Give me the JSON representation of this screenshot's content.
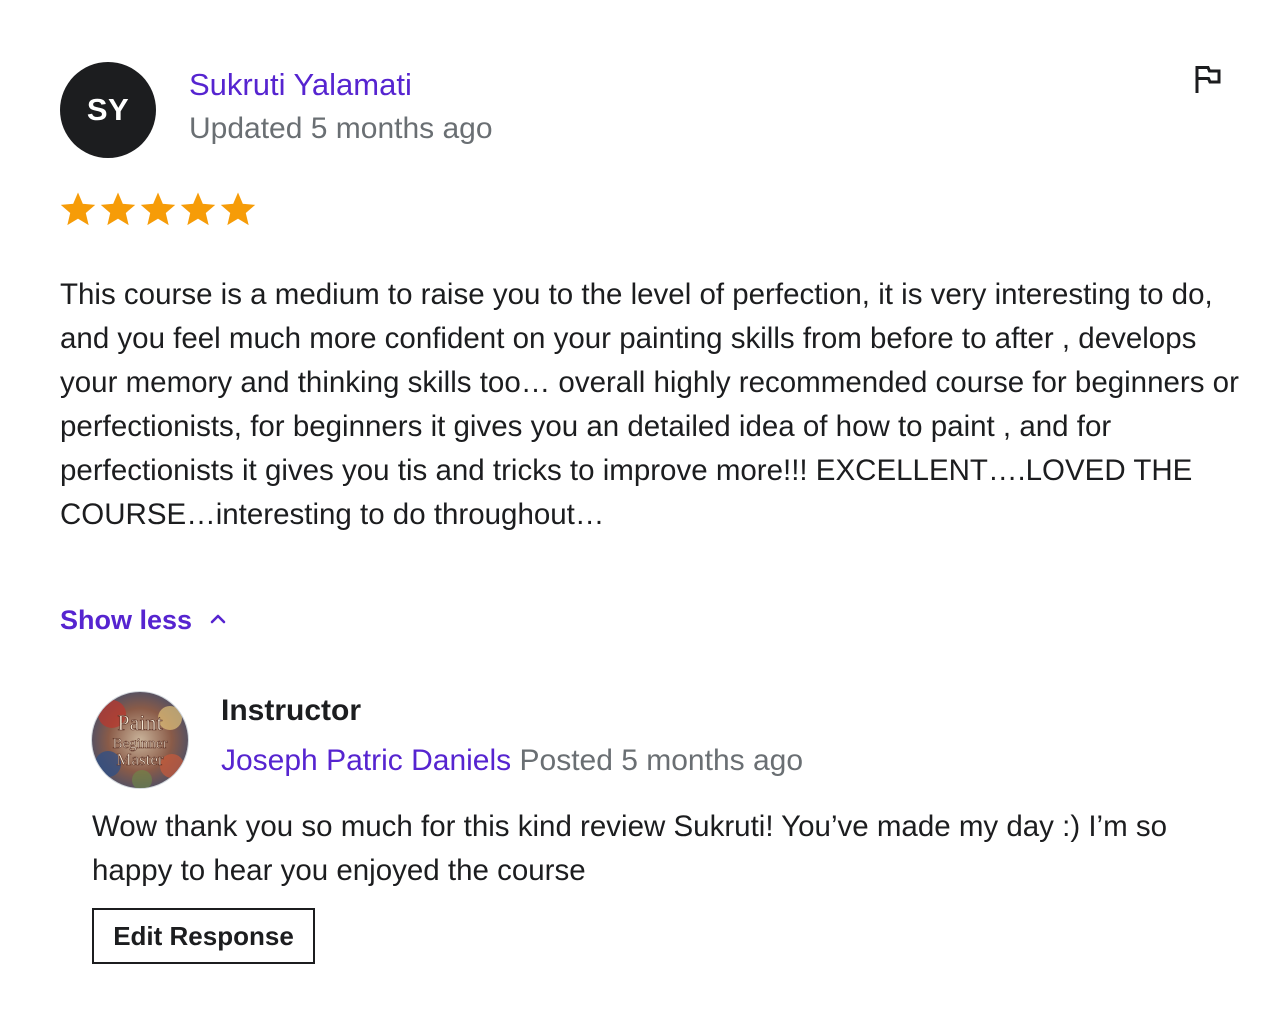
{
  "review": {
    "avatar_initials": "SY",
    "reviewer_name": "Sukruti Yalamati",
    "updated_text": "Updated 5 months ago",
    "rating": 5,
    "rating_max": 5,
    "star_color": "#f69c08",
    "text": "This course is a medium to raise you to the level of perfection, it is very interesting to do, and you feel much more confident on your painting skills from before to after , develops your memory and thinking skills too… overall highly recommended course for beginners or perfectionists, for beginners it gives you an detailed idea of how to paint , and for perfectionists it gives you tis and tricks to improve more!!! EXCELLENT….LOVED THE COURSE…interesting to do throughout…",
    "show_less_label": "Show less",
    "flag_icon": "flag-icon",
    "toggle_icon": "chevron-up-icon"
  },
  "response": {
    "role_label": "Instructor",
    "instructor_name": "Joseph Patric Daniels",
    "posted_text": "Posted 5 months ago",
    "avatar_text": [
      "Paint",
      "Beginner",
      "Master"
    ],
    "text": "Wow thank you so much for this kind review Sukruti! You’ve made my day :) I’m so happy to hear you enjoyed the course",
    "edit_button_label": "Edit Response"
  },
  "colors": {
    "accent": "#5624d0",
    "muted": "#6a6f73",
    "text": "#1c1d1f"
  }
}
